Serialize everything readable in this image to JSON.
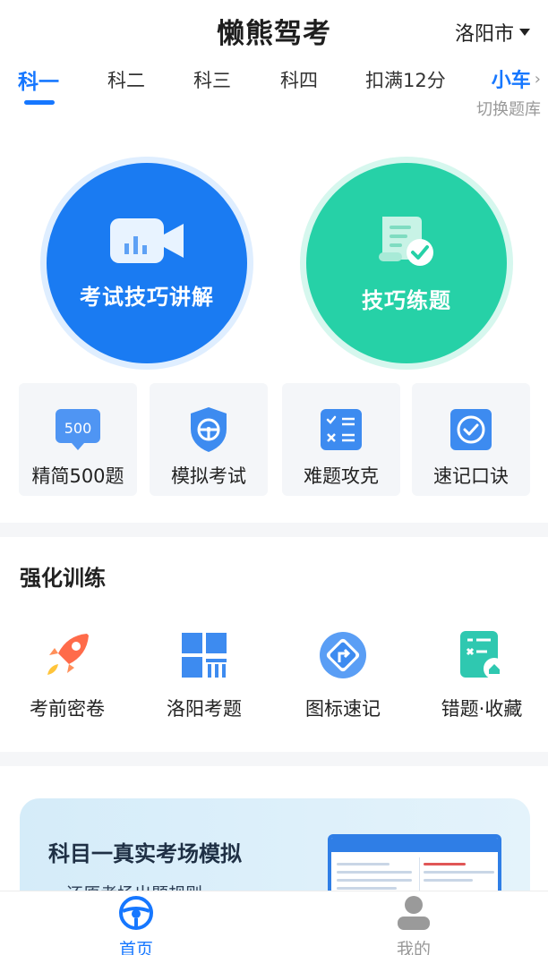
{
  "header": {
    "title": "懒熊驾考",
    "city": "洛阳市"
  },
  "tabs": [
    {
      "label": "科一",
      "active": true
    },
    {
      "label": "科二",
      "active": false
    },
    {
      "label": "科三",
      "active": false
    },
    {
      "label": "科四",
      "active": false
    },
    {
      "label": "扣满12分",
      "active": false
    }
  ],
  "vehicle": {
    "label": "小车",
    "switch_label": "切换题库"
  },
  "main_actions": [
    {
      "label": "考试技巧讲解",
      "icon": "video-camera-icon",
      "color": "#1a7bf2"
    },
    {
      "label": "技巧练题",
      "icon": "exam-paper-check-icon",
      "color": "#26d1a7"
    }
  ],
  "quick_entries": [
    {
      "label": "精简500题",
      "icon": "500-badge-icon",
      "badge_text": "500"
    },
    {
      "label": "模拟考试",
      "icon": "steering-shield-icon"
    },
    {
      "label": "难题攻克",
      "icon": "calculator-icon"
    },
    {
      "label": "速记口诀",
      "icon": "check-circle-icon"
    }
  ],
  "strengthen": {
    "title": "强化训练",
    "items": [
      {
        "label": "考前密卷",
        "icon": "rocket-icon"
      },
      {
        "label": "洛阳考题",
        "icon": "city-grid-icon"
      },
      {
        "label": "图标速记",
        "icon": "road-sign-icon"
      },
      {
        "label": "错题·收藏",
        "icon": "wrong-questions-icon"
      }
    ]
  },
  "banner": {
    "title": "科目一真实考场模拟",
    "subtitle": "还原考场出题规则"
  },
  "bottom_nav": [
    {
      "label": "首页",
      "icon": "steering-wheel-icon",
      "active": true
    },
    {
      "label": "我的",
      "icon": "user-icon",
      "active": false
    }
  ],
  "colors": {
    "primary": "#1677ff",
    "green": "#26d1a7",
    "muted": "#999999"
  }
}
